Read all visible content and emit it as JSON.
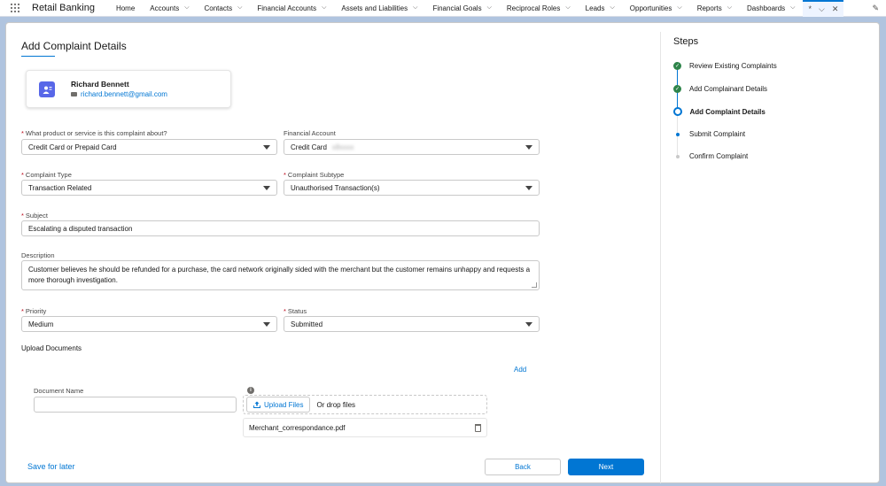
{
  "nav": {
    "app_name": "Retail Banking",
    "items": [
      {
        "label": "Home",
        "chevron": false
      },
      {
        "label": "Accounts",
        "chevron": true
      },
      {
        "label": "Contacts",
        "chevron": true
      },
      {
        "label": "Financial Accounts",
        "chevron": true
      },
      {
        "label": "Assets and Liabilities",
        "chevron": true
      },
      {
        "label": "Financial Goals",
        "chevron": true
      },
      {
        "label": "Reciprocal Roles",
        "chevron": true
      },
      {
        "label": "Leads",
        "chevron": true
      },
      {
        "label": "Opportunities",
        "chevron": true
      },
      {
        "label": "Reports",
        "chevron": true
      },
      {
        "label": "Dashboards",
        "chevron": true
      }
    ],
    "active_tab": "*"
  },
  "form": {
    "title": "Add Complaint Details",
    "contact": {
      "name": "Richard Bennett",
      "email": "richard.bennett@gmail.com"
    },
    "product": {
      "label": "What product or service is this complaint about?",
      "value": "Credit Card or Prepaid Card"
    },
    "financial_account": {
      "label": "Financial Account",
      "value": "Credit Card",
      "masked": "x8xxxx"
    },
    "complaint_type": {
      "label": "Complaint Type",
      "value": "Transaction Related"
    },
    "complaint_subtype": {
      "label": "Complaint Subtype",
      "value": "Unauthorised Transaction(s)"
    },
    "subject": {
      "label": "Subject",
      "value": "Escalating a disputed transaction"
    },
    "description": {
      "label": "Description",
      "value": "Customer believes he should be refunded for a purchase, the card network originally sided with the merchant but the customer remains unhappy and requests a more thorough investigation."
    },
    "priority": {
      "label": "Priority",
      "value": "Medium"
    },
    "status": {
      "label": "Status",
      "value": "Submitted"
    },
    "upload": {
      "section_label": "Upload Documents",
      "add_label": "Add",
      "doc_name_label": "Document Name",
      "doc_name_value": "",
      "upload_button": "Upload Files",
      "drop_text": "Or drop files",
      "file_name": "Merchant_correspondance.pdf"
    },
    "save_later": "Save for later",
    "back": "Back",
    "next": "Next"
  },
  "steps": {
    "title": "Steps",
    "items": [
      {
        "label": "Review Existing Complaints",
        "state": "done"
      },
      {
        "label": "Add Complainant Details",
        "state": "done"
      },
      {
        "label": "Add Complaint Details",
        "state": "current"
      },
      {
        "label": "Submit Complaint",
        "state": "next"
      },
      {
        "label": "Confirm Complaint",
        "state": "future"
      }
    ]
  }
}
